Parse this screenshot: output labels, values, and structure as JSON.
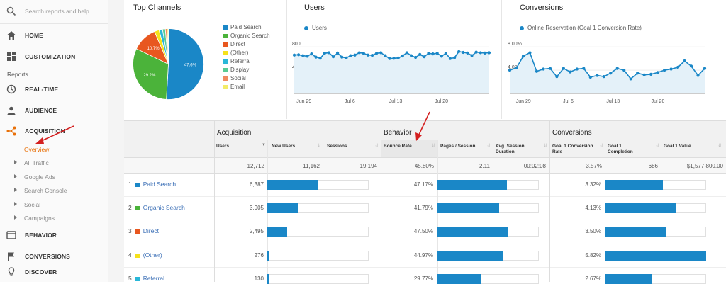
{
  "sidebar": {
    "search_placeholder": "Search reports and help",
    "home": "HOME",
    "customization": "CUSTOMIZATION",
    "reports": "Reports",
    "realtime": "REAL-TIME",
    "audience": "AUDIENCE",
    "acquisition": "ACQUISITION",
    "acq_sub": [
      "Overview",
      "All Traffic",
      "Google Ads",
      "Search Console",
      "Social",
      "Campaigns"
    ],
    "behavior": "BEHAVIOR",
    "conversions": "CONVERSIONS",
    "discover": "DISCOVER",
    "accent_color": "#e8710a"
  },
  "top_channels": {
    "title": "Top Channels",
    "legend": [
      {
        "label": "Paid Search",
        "color": "#1a87c7"
      },
      {
        "label": "Organic Search",
        "color": "#4bb33a"
      },
      {
        "label": "Direct",
        "color": "#e8571f"
      },
      {
        "label": "(Other)",
        "color": "#f5e11b"
      },
      {
        "label": "Referral",
        "color": "#29b7d8"
      },
      {
        "label": "Display",
        "color": "#58cb93"
      },
      {
        "label": "Social",
        "color": "#f08a60"
      },
      {
        "label": "Email",
        "color": "#f3ec68"
      }
    ],
    "pie_labels": [
      "47.6%",
      "29.2%",
      "10.7%"
    ]
  },
  "users_panel": {
    "title": "Users",
    "legend": "Users",
    "y_labels": [
      "800",
      "400"
    ],
    "x_labels": [
      "Jun 29",
      "Jul 6",
      "Jul 13",
      "Jul 20"
    ]
  },
  "conversions_panel": {
    "title": "Conversions",
    "legend": "Online Reservation (Goal 1 Conversion Rate)",
    "y_labels": [
      "8.00%",
      "4.00%"
    ],
    "x_labels": [
      "Jun 29",
      "Jul 6",
      "Jul 13",
      "Jul 20"
    ]
  },
  "table": {
    "groups": [
      "Acquisition",
      "Behavior",
      "Conversions"
    ],
    "headers": [
      "Users",
      "New Users",
      "Sessions",
      "Bounce Rate",
      "Pages / Session",
      "Avg. Session Duration",
      "Goal 1 Conversion Rate",
      "Goal 1 Completion",
      "Goal 1 Value"
    ],
    "totals": [
      "12,712",
      "11,162",
      "19,194",
      "45.80%",
      "2.11",
      "00:02:08",
      "3.57%",
      "686",
      "$1,577,800.00"
    ],
    "rows": [
      {
        "idx": "1",
        "name": "Paid Search",
        "users": "6,387",
        "bounce": "47.17%",
        "conv": "3.32%"
      },
      {
        "idx": "2",
        "name": "Organic Search",
        "users": "3,905",
        "bounce": "41.79%",
        "conv": "4.13%"
      },
      {
        "idx": "3",
        "name": "Direct",
        "users": "2,495",
        "bounce": "47.50%",
        "conv": "3.50%"
      },
      {
        "idx": "4",
        "name": "(Other)",
        "users": "276",
        "bounce": "44.97%",
        "conv": "5.82%"
      },
      {
        "idx": "5",
        "name": "Referral",
        "users": "130",
        "bounce": "29.77%",
        "conv": "2.67%"
      }
    ]
  },
  "chart_data": [
    {
      "type": "pie",
      "title": "Top Channels",
      "categories": [
        "Paid Search",
        "Organic Search",
        "Direct",
        "(Other)",
        "Referral",
        "Display",
        "Social",
        "Email"
      ],
      "values": [
        47.6,
        29.2,
        10.7,
        2.0,
        1.5,
        1.2,
        0.8,
        0.5
      ]
    },
    {
      "type": "line",
      "title": "Users",
      "x_labels": [
        "Jun 29",
        "Jul 6",
        "Jul 13",
        "Jul 20"
      ],
      "series": [
        {
          "name": "Users",
          "values": [
            660,
            665,
            650,
            640,
            680,
            625,
            605,
            690,
            700,
            630,
            695,
            625,
            610,
            650,
            660,
            700,
            690,
            660,
            655,
            690,
            700,
            650,
            600,
            605,
            610,
            645,
            700,
            650,
            620,
            670,
            630,
            690,
            680,
            690,
            640,
            690,
            600,
            615,
            720,
            705,
            695,
            650,
            710,
            700,
            695,
            700
          ]
        }
      ],
      "ylim": [
        0,
        900
      ]
    },
    {
      "type": "line",
      "title": "Conversions",
      "x_labels": [
        "Jun 29",
        "Jul 6",
        "Jul 13",
        "Jul 20"
      ],
      "series": [
        {
          "name": "Online Reservation (Goal 1 Conversion Rate)",
          "values": [
            4.0,
            4.4,
            6.4,
            7.0,
            3.8,
            4.2,
            4.3,
            2.9,
            4.3,
            3.7,
            4.2,
            4.3,
            2.8,
            3.1,
            2.9,
            3.5,
            4.3,
            4.0,
            2.5,
            3.5,
            3.2,
            3.3,
            3.6,
            4.0,
            4.2,
            4.5,
            5.6,
            4.7,
            3.1,
            4.3
          ]
        }
      ],
      "ylim": [
        0,
        9
      ]
    }
  ]
}
